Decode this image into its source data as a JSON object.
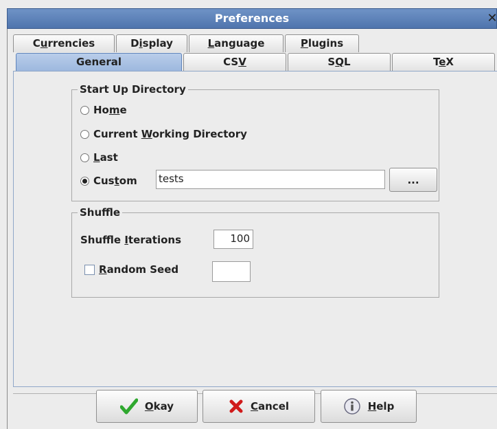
{
  "window": {
    "title": "Preferences",
    "close_glyph": "✕"
  },
  "tabs_row1": [
    {
      "label": "Currencies",
      "mn": "u"
    },
    {
      "label": "Display",
      "mn": "i"
    },
    {
      "label": "Language",
      "mn": "L"
    },
    {
      "label": "Plugins",
      "mn": "P"
    }
  ],
  "tabs_row2": [
    {
      "label": "General",
      "active": true
    },
    {
      "label": "CSV",
      "mn": "V"
    },
    {
      "label": "SQL",
      "mn": "Q"
    },
    {
      "label": "TeX",
      "mn": "e"
    }
  ],
  "startup": {
    "title": "Start Up Directory",
    "home": "Home",
    "cwd": "Current Working Directory",
    "last": "Last",
    "custom": "Custom",
    "custom_value": "tests",
    "browse": "...",
    "selected": "custom"
  },
  "shuffle": {
    "title": "Shuffle",
    "iterations_label": "Shuffle Iterations",
    "iterations_value": "100",
    "seed_label": "Random Seed",
    "seed_checked": false,
    "seed_value": ""
  },
  "buttons": {
    "okay": "Okay",
    "cancel": "Cancel",
    "help": "Help"
  },
  "icons": {
    "okay": "check-icon",
    "cancel": "x-icon",
    "help": "info-icon"
  },
  "colors": {
    "okay_icon": "#2fa82f",
    "cancel_icon": "#d01a1a",
    "active_tab": "#a9c2e4",
    "titlebar": "#5a7fb5"
  }
}
